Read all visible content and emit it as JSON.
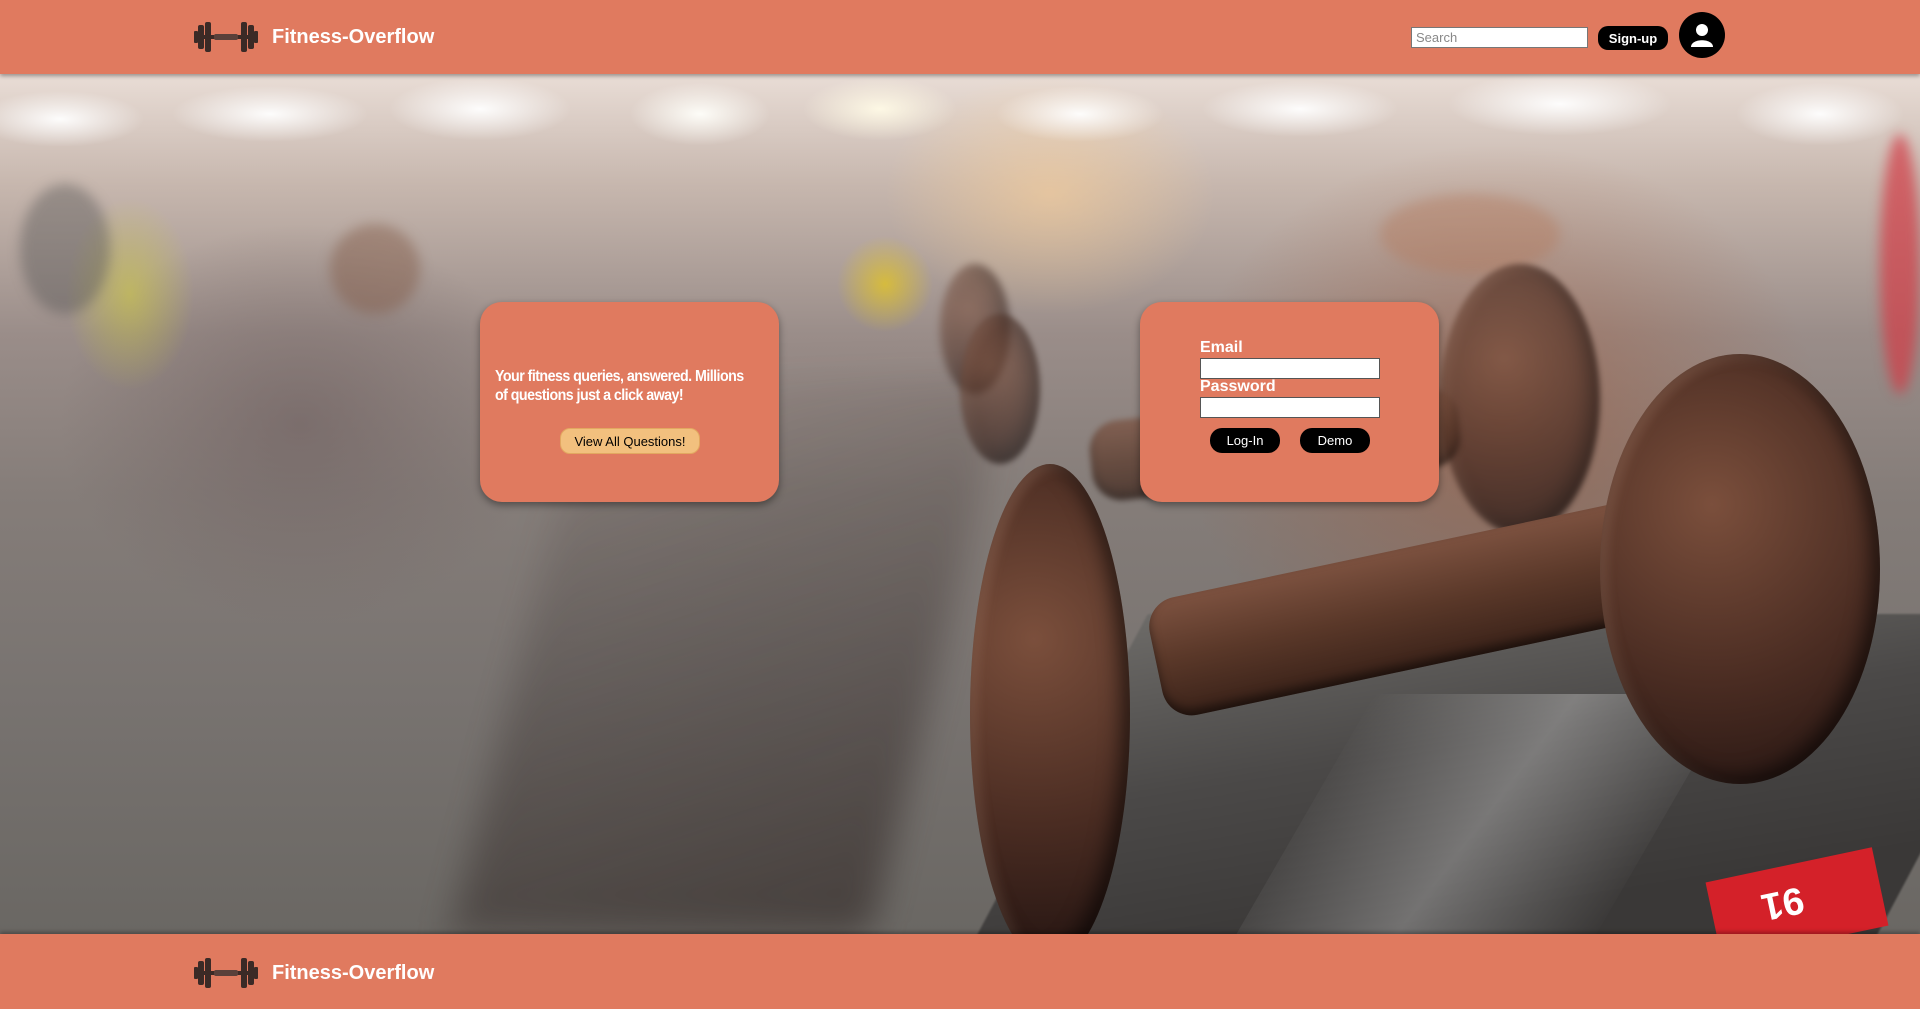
{
  "header": {
    "brand_name": "Fitness-Overflow",
    "logo_icon": "dumbbell-icon",
    "search_placeholder": "Search",
    "signup_label": "Sign-up",
    "avatar_icon": "user-icon"
  },
  "promo": {
    "tagline": "Your fitness queries, answered. Millions of questions just a click away!",
    "view_all_label": "View All Questions!"
  },
  "login": {
    "email_label": "Email",
    "password_label": "Password",
    "email_value": "",
    "password_value": "",
    "login_label": "Log-In",
    "demo_label": "Demo"
  },
  "footer": {
    "brand_name": "Fitness-Overflow",
    "logo_icon": "dumbbell-icon"
  },
  "background": {
    "description_icon": "gym-dumbbell-rack-photo",
    "tag_text": "91"
  },
  "colors": {
    "brand": "#e07a5f",
    "button_dark": "#000000",
    "button_accent": "#f2c07e"
  }
}
